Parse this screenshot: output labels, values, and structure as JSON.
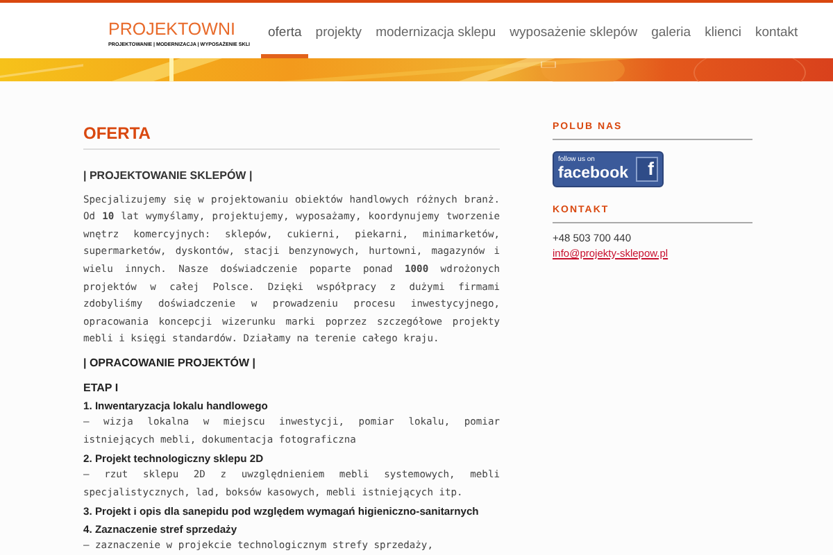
{
  "logo": {
    "name": "PROJEKTOWNI",
    "tagline": "PROJEKTOWANIE | MODERNIZACJA | WYPOSAŻENIE SKLI"
  },
  "nav": [
    {
      "label": "oferta",
      "selected": true
    },
    {
      "label": "projekty",
      "selected": false
    },
    {
      "label": "modernizacja sklepu",
      "selected": false
    },
    {
      "label": "wyposażenie sklepów",
      "selected": false
    },
    {
      "label": "galeria",
      "selected": false
    },
    {
      "label": "klienci",
      "selected": false
    },
    {
      "label": "kontakt",
      "selected": false
    }
  ],
  "main": {
    "title": "OFERTA",
    "section_1": {
      "heading": "| PROJEKTOWANIE SKLEPÓW |",
      "paragraph": "Specjalizujemy się w projektowaniu obiektów handlowych różnych branż. Od **10** lat wymyślamy, projektujemy, wyposażamy, koordynujemy tworzenie wnętrz komercyjnych: sklepów, cukierni, piekarni, minimarketów, supermarketów, dyskontów, stacji benzynowych, hurtowni, magazynów i wielu innych. Nasze doświadczenie poparte ponad **1000** wdrożonych projektów w całej Polsce. Dzięki współpracy z dużymi firmami zdobyliśmy doświadczenie w prowadzeniu procesu inwestycyjnego, opracowania koncepcji wizerunku marki poprzez szczegółowe projekty mebli i księgi standardów. Działamy na terenie całego kraju."
    },
    "section_2": {
      "heading": "| OPRACOWANIE PROJEKTÓW |",
      "stage": "ETAP I",
      "steps": [
        {
          "title": "1. Inwentaryzacja lokalu handlowego",
          "description": "– wizja lokalna w miejscu inwestycji, pomiar lokalu, pomiar istniejących mebli, dokumentacja fotograficzna"
        },
        {
          "title": "2. Projekt technologiczny sklepu 2D",
          "description": "– rzut sklepu 2D z uwzględnieniem mebli systemowych, mebli specjalistycznych, lad, boksów kasowych, mebli istniejących itp."
        },
        {
          "title": "3. Projekt i opis dla sanepidu pod względem wymagań higieniczno-sanitarnych"
        },
        {
          "title": "4. Zaznaczenie stref sprzedaży",
          "description": "– zaznaczenie w projekcie technologicznym strefy sprzedaży,"
        }
      ]
    }
  },
  "sidebar": {
    "like_heading": "POLUB NAS",
    "facebook_button": {
      "small": "follow us on",
      "big": "facebook",
      "letter": "f"
    },
    "contact_heading": "KONTAKT",
    "phone": "+48 503 700 440",
    "email": "info@projekty-sklepow.pl"
  }
}
